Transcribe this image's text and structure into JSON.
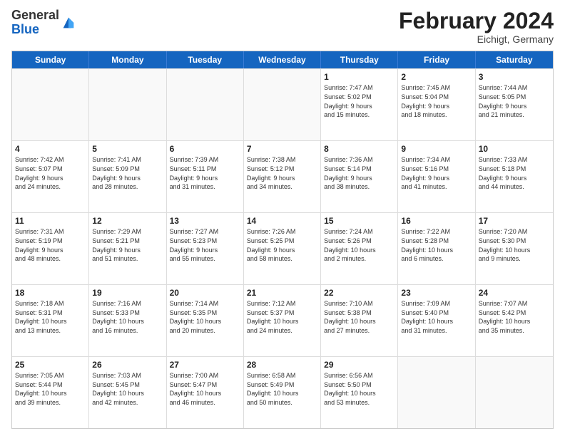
{
  "logo": {
    "general": "General",
    "blue": "Blue"
  },
  "title": {
    "month_year": "February 2024",
    "location": "Eichigt, Germany"
  },
  "header_days": [
    "Sunday",
    "Monday",
    "Tuesday",
    "Wednesday",
    "Thursday",
    "Friday",
    "Saturday"
  ],
  "weeks": [
    [
      {
        "day": "",
        "text": ""
      },
      {
        "day": "",
        "text": ""
      },
      {
        "day": "",
        "text": ""
      },
      {
        "day": "",
        "text": ""
      },
      {
        "day": "1",
        "text": "Sunrise: 7:47 AM\nSunset: 5:02 PM\nDaylight: 9 hours\nand 15 minutes."
      },
      {
        "day": "2",
        "text": "Sunrise: 7:45 AM\nSunset: 5:04 PM\nDaylight: 9 hours\nand 18 minutes."
      },
      {
        "day": "3",
        "text": "Sunrise: 7:44 AM\nSunset: 5:05 PM\nDaylight: 9 hours\nand 21 minutes."
      }
    ],
    [
      {
        "day": "4",
        "text": "Sunrise: 7:42 AM\nSunset: 5:07 PM\nDaylight: 9 hours\nand 24 minutes."
      },
      {
        "day": "5",
        "text": "Sunrise: 7:41 AM\nSunset: 5:09 PM\nDaylight: 9 hours\nand 28 minutes."
      },
      {
        "day": "6",
        "text": "Sunrise: 7:39 AM\nSunset: 5:11 PM\nDaylight: 9 hours\nand 31 minutes."
      },
      {
        "day": "7",
        "text": "Sunrise: 7:38 AM\nSunset: 5:12 PM\nDaylight: 9 hours\nand 34 minutes."
      },
      {
        "day": "8",
        "text": "Sunrise: 7:36 AM\nSunset: 5:14 PM\nDaylight: 9 hours\nand 38 minutes."
      },
      {
        "day": "9",
        "text": "Sunrise: 7:34 AM\nSunset: 5:16 PM\nDaylight: 9 hours\nand 41 minutes."
      },
      {
        "day": "10",
        "text": "Sunrise: 7:33 AM\nSunset: 5:18 PM\nDaylight: 9 hours\nand 44 minutes."
      }
    ],
    [
      {
        "day": "11",
        "text": "Sunrise: 7:31 AM\nSunset: 5:19 PM\nDaylight: 9 hours\nand 48 minutes."
      },
      {
        "day": "12",
        "text": "Sunrise: 7:29 AM\nSunset: 5:21 PM\nDaylight: 9 hours\nand 51 minutes."
      },
      {
        "day": "13",
        "text": "Sunrise: 7:27 AM\nSunset: 5:23 PM\nDaylight: 9 hours\nand 55 minutes."
      },
      {
        "day": "14",
        "text": "Sunrise: 7:26 AM\nSunset: 5:25 PM\nDaylight: 9 hours\nand 58 minutes."
      },
      {
        "day": "15",
        "text": "Sunrise: 7:24 AM\nSunset: 5:26 PM\nDaylight: 10 hours\nand 2 minutes."
      },
      {
        "day": "16",
        "text": "Sunrise: 7:22 AM\nSunset: 5:28 PM\nDaylight: 10 hours\nand 6 minutes."
      },
      {
        "day": "17",
        "text": "Sunrise: 7:20 AM\nSunset: 5:30 PM\nDaylight: 10 hours\nand 9 minutes."
      }
    ],
    [
      {
        "day": "18",
        "text": "Sunrise: 7:18 AM\nSunset: 5:31 PM\nDaylight: 10 hours\nand 13 minutes."
      },
      {
        "day": "19",
        "text": "Sunrise: 7:16 AM\nSunset: 5:33 PM\nDaylight: 10 hours\nand 16 minutes."
      },
      {
        "day": "20",
        "text": "Sunrise: 7:14 AM\nSunset: 5:35 PM\nDaylight: 10 hours\nand 20 minutes."
      },
      {
        "day": "21",
        "text": "Sunrise: 7:12 AM\nSunset: 5:37 PM\nDaylight: 10 hours\nand 24 minutes."
      },
      {
        "day": "22",
        "text": "Sunrise: 7:10 AM\nSunset: 5:38 PM\nDaylight: 10 hours\nand 27 minutes."
      },
      {
        "day": "23",
        "text": "Sunrise: 7:09 AM\nSunset: 5:40 PM\nDaylight: 10 hours\nand 31 minutes."
      },
      {
        "day": "24",
        "text": "Sunrise: 7:07 AM\nSunset: 5:42 PM\nDaylight: 10 hours\nand 35 minutes."
      }
    ],
    [
      {
        "day": "25",
        "text": "Sunrise: 7:05 AM\nSunset: 5:44 PM\nDaylight: 10 hours\nand 39 minutes."
      },
      {
        "day": "26",
        "text": "Sunrise: 7:03 AM\nSunset: 5:45 PM\nDaylight: 10 hours\nand 42 minutes."
      },
      {
        "day": "27",
        "text": "Sunrise: 7:00 AM\nSunset: 5:47 PM\nDaylight: 10 hours\nand 46 minutes."
      },
      {
        "day": "28",
        "text": "Sunrise: 6:58 AM\nSunset: 5:49 PM\nDaylight: 10 hours\nand 50 minutes."
      },
      {
        "day": "29",
        "text": "Sunrise: 6:56 AM\nSunset: 5:50 PM\nDaylight: 10 hours\nand 53 minutes."
      },
      {
        "day": "",
        "text": ""
      },
      {
        "day": "",
        "text": ""
      }
    ]
  ]
}
